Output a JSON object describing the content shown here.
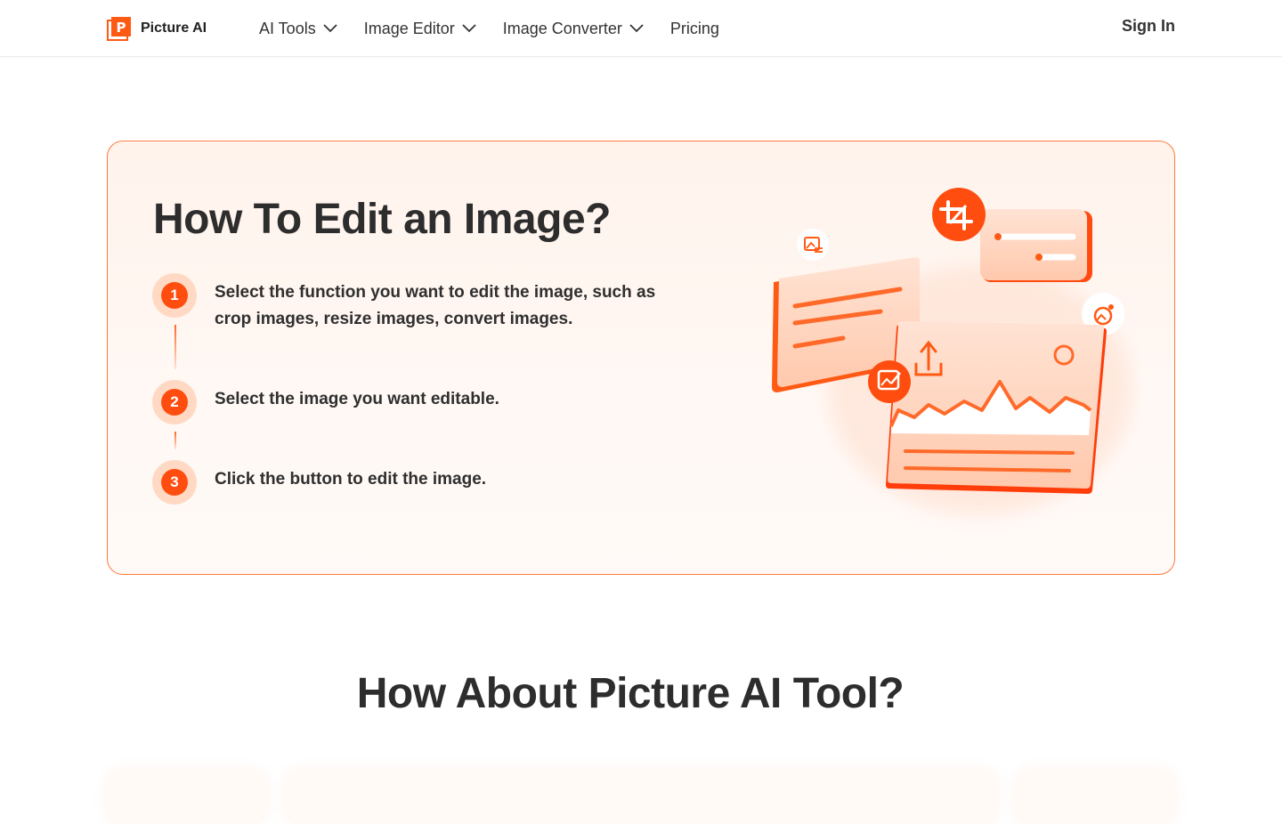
{
  "header": {
    "brand": "Picture AI",
    "nav": [
      {
        "label": "AI Tools",
        "has_dropdown": true
      },
      {
        "label": "Image Editor",
        "has_dropdown": true
      },
      {
        "label": "Image Converter",
        "has_dropdown": true
      },
      {
        "label": "Pricing",
        "has_dropdown": false
      }
    ],
    "sign_in": "Sign In"
  },
  "how_to": {
    "title": "How To Edit an Image?",
    "steps": [
      {
        "number": "1",
        "text": "Select the function you want to edit the image, such as crop images, resize images, convert images."
      },
      {
        "number": "2",
        "text": "Select the image you want editable."
      },
      {
        "number": "3",
        "text": "Click the button to edit the image."
      }
    ]
  },
  "about": {
    "title": "How About Picture AI Tool?"
  },
  "colors": {
    "accent": "#ff4d0f",
    "accent_light": "#ffd9c4",
    "card_bg": "#fff4ee",
    "border": "#ff7a3d"
  },
  "icons": [
    "logo-p-icon",
    "chevron-down-icon",
    "crop-icon",
    "image-edit-icon",
    "upload-icon",
    "image-settings-icon",
    "image-swap-icon"
  ]
}
